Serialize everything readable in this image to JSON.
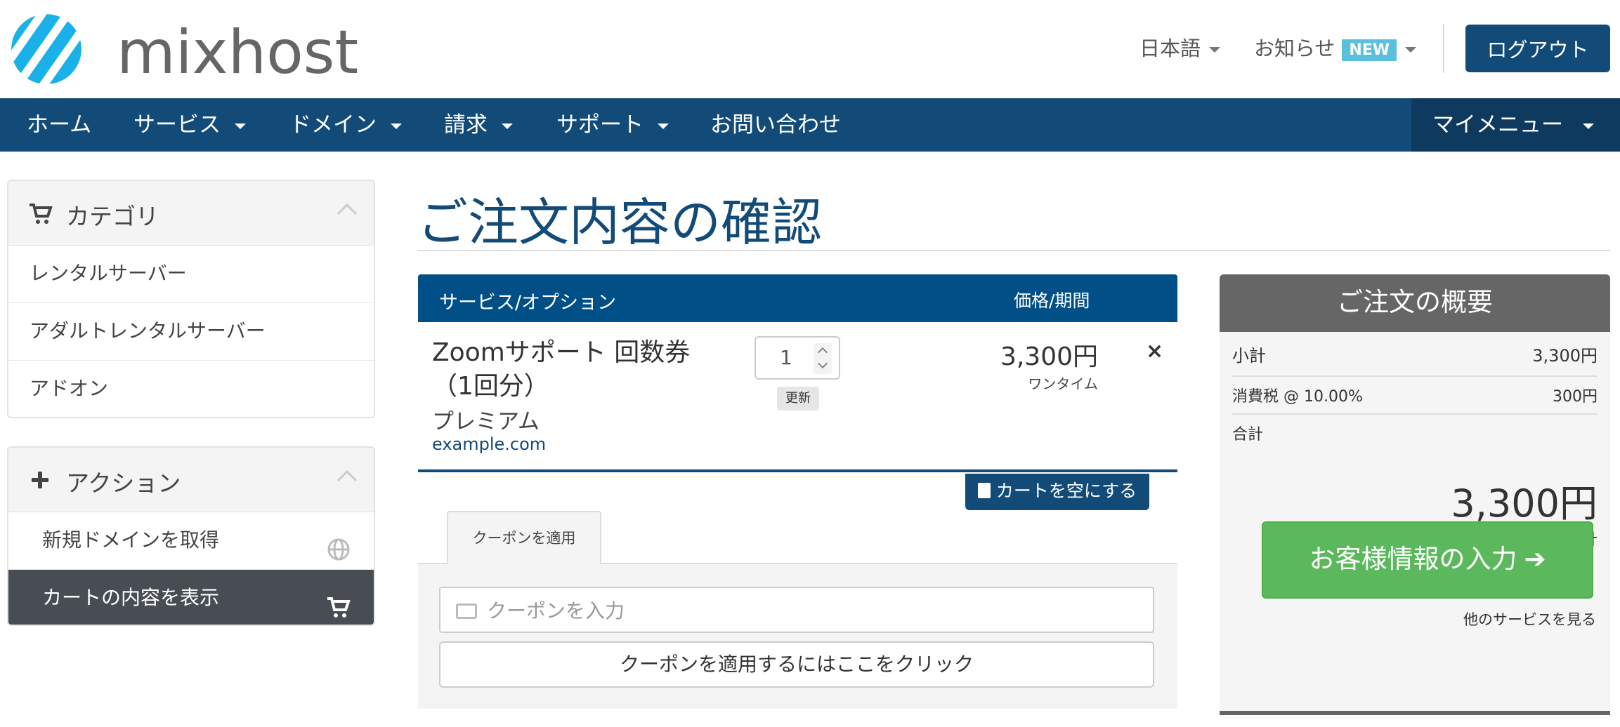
{
  "brand": {
    "name": "mixhost"
  },
  "header": {
    "language": "日本語",
    "news": "お知らせ",
    "news_badge": "NEW",
    "logout": "ログアウト"
  },
  "nav": {
    "home": "ホーム",
    "services": "サービス",
    "domains": "ドメイン",
    "billing": "請求",
    "support": "サポート",
    "contact": "お問い合わせ",
    "my_menu": "マイメニュー"
  },
  "sidebar": {
    "categories": {
      "title": "カテゴリ",
      "items": [
        "レンタルサーバー",
        "アダルトレンタルサーバー",
        "アドオン"
      ]
    },
    "actions": {
      "title": "アクション",
      "items": [
        "新規ドメインを取得",
        "カートの内容を表示"
      ]
    }
  },
  "main": {
    "title": "ご注文内容の確認",
    "table": {
      "col_service": "サービス/オプション",
      "col_price": "価格/期間"
    },
    "item": {
      "name": "Zoomサポート 回数券（1回分）",
      "variant": "プレミアム",
      "domain": "example.com",
      "quantity": "1",
      "update": "更新",
      "price": "3,300円",
      "cycle": "ワンタイム",
      "remove": "×"
    },
    "empty_cart": "カートを空にする",
    "coupon": {
      "tab": "クーポンを適用",
      "placeholder": "クーポンを入力",
      "apply": "クーポンを適用するにはここをクリック"
    }
  },
  "summary": {
    "title": "ご注文の概要",
    "subtotal_label": "小計",
    "subtotal": "3,300円",
    "tax_label": "消費税 @ 10.00%",
    "tax": "300円",
    "total_label": "合計",
    "total": "3,300円",
    "total_caption": "合計",
    "checkout": "お客様情報の入力",
    "continue": "他のサービスを見る"
  },
  "colors": {
    "primary": "#134b78",
    "table_head": "#004f86",
    "accent_logo": "#1ab0e8",
    "success": "#5cb85c",
    "summary_head": "#666666"
  }
}
